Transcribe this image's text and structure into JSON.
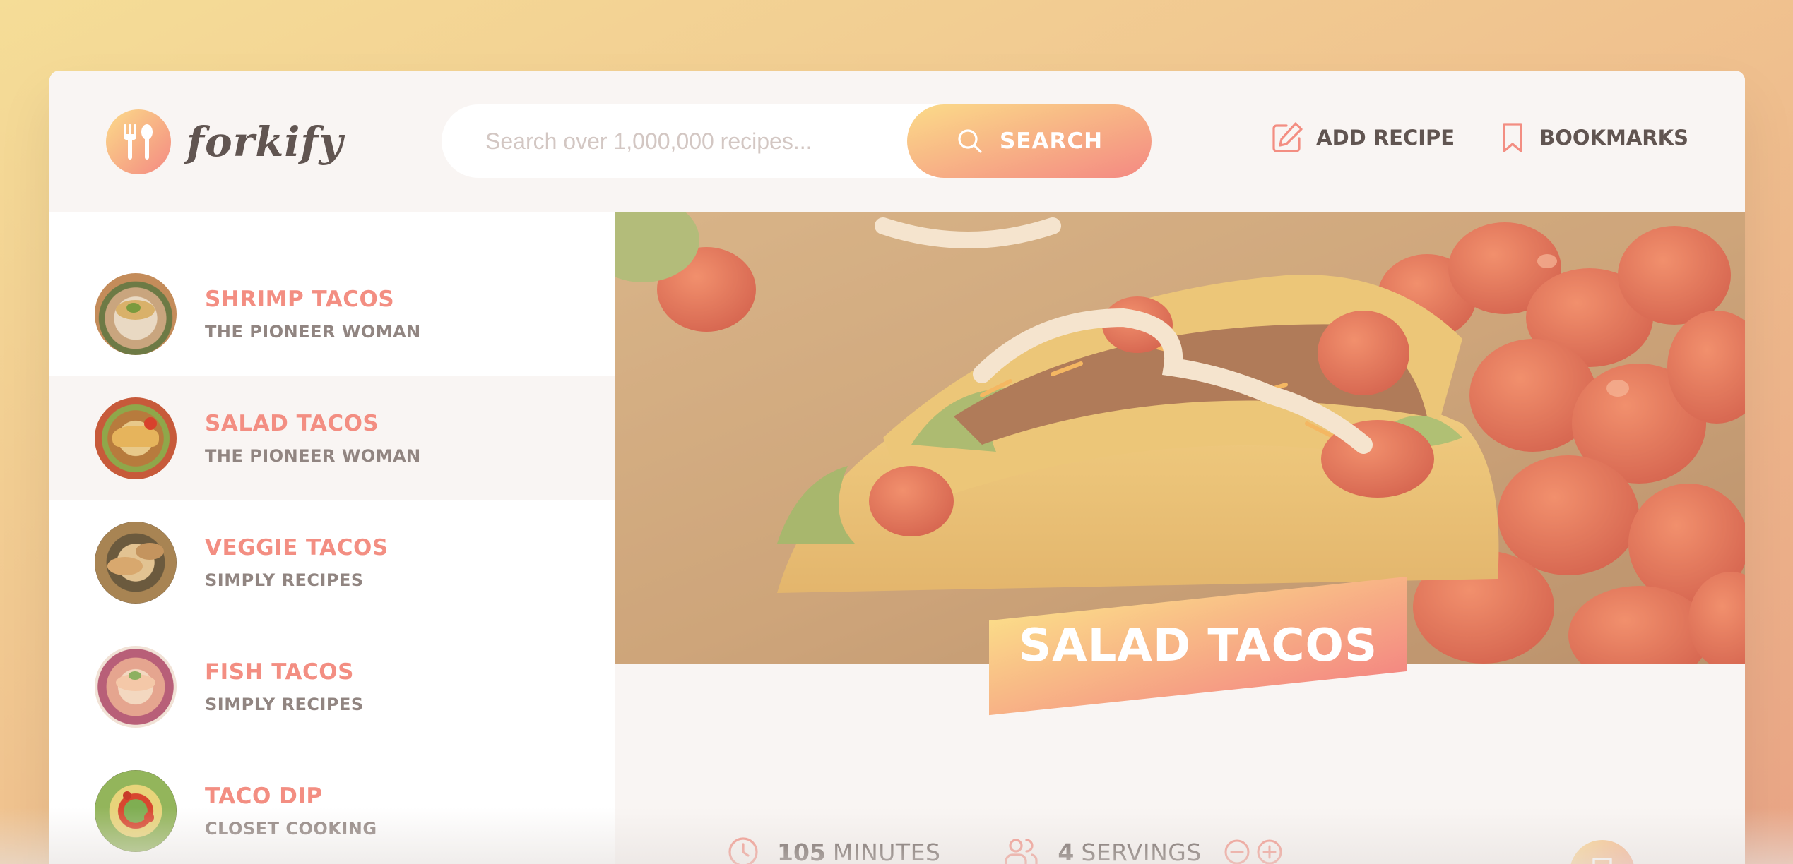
{
  "header": {
    "logo_text": "forkify",
    "search": {
      "placeholder": "Search over 1,000,000 recipes...",
      "value": ""
    },
    "search_label": "SEARCH",
    "nav": {
      "add_recipe": "ADD RECIPE",
      "bookmarks": "BOOKMARKS"
    }
  },
  "results": [
    {
      "title": "SHRIMP TACOS",
      "publisher": "THE PIONEER WOMAN",
      "active": false
    },
    {
      "title": "SALAD TACOS",
      "publisher": "THE PIONEER WOMAN",
      "active": true
    },
    {
      "title": "VEGGIE TACOS",
      "publisher": "SIMPLY RECIPES",
      "active": false
    },
    {
      "title": "FISH TACOS",
      "publisher": "SIMPLY RECIPES",
      "active": false
    },
    {
      "title": "TACO DIP",
      "publisher": "CLOSET COOKING",
      "active": false
    }
  ],
  "recipe": {
    "title": "SALAD TACOS",
    "minutes": "105",
    "minutes_label": "MINUTES",
    "servings": "4",
    "servings_label": "SERVINGS"
  },
  "colors": {
    "accent": "#f38e82",
    "gradient_start": "#fbdb89",
    "gradient_end": "#f48982",
    "text": "#615551"
  }
}
